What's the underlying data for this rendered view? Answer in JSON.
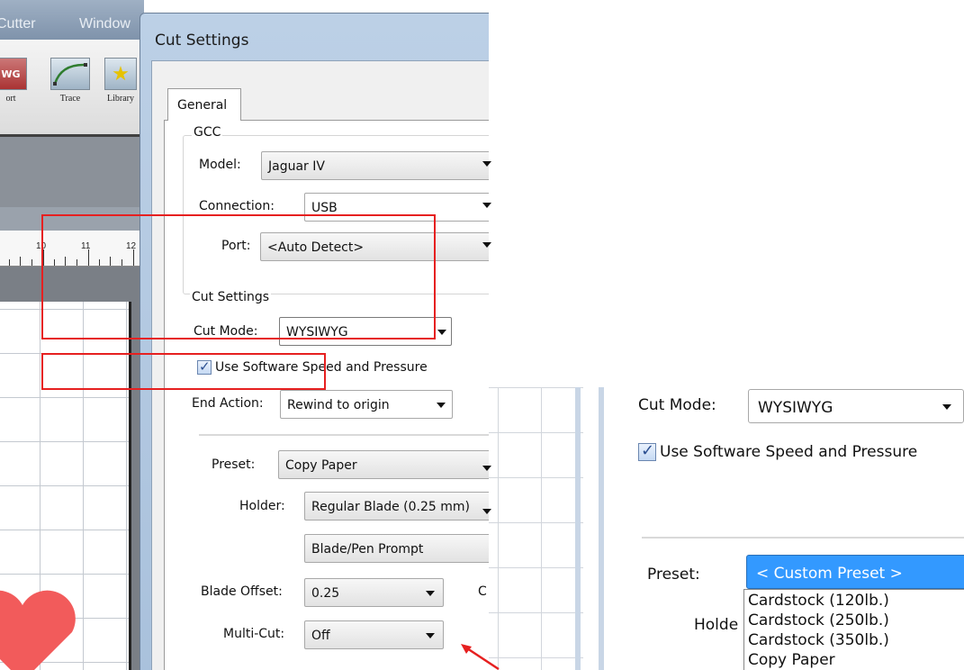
{
  "app": {
    "menu": [
      "Cutter",
      "Window"
    ],
    "tools": [
      {
        "label": "ort",
        "icon": "wysiwyg-icon"
      },
      {
        "label": "Trace",
        "icon": "trace-icon"
      },
      {
        "label": "Library",
        "icon": "star-icon"
      }
    ],
    "ruler": [
      "10",
      "11",
      "12"
    ]
  },
  "dialog": {
    "title": "Cut Settings",
    "tab": "General",
    "gcc": {
      "title": "GCC",
      "model_label": "Model:",
      "model_value": "Jaguar IV",
      "connection_label": "Connection:",
      "connection_value": "USB",
      "port_label": "Port:",
      "port_value": "<Auto Detect>"
    },
    "cut_settings": {
      "title": "Cut Settings",
      "cut_mode_label": "Cut Mode:",
      "cut_mode_value": "WYSIWYG",
      "use_software_label": "Use Software Speed and Pressure",
      "end_action_label": "End Action:",
      "end_action_value": "Rewind to origin"
    },
    "preset_label": "Preset:",
    "preset_value": "Copy Paper",
    "holder_label": "Holder:",
    "holder_value": "Regular Blade (0.25 mm)",
    "blade_prompt_value": "Blade/Pen Prompt",
    "blade_offset_label": "Blade Offset:",
    "blade_offset_value": "0.25",
    "multicut_label": "Multi-Cut:",
    "multicut_value": "Off",
    "right_edge_char": "C"
  },
  "inset": {
    "cut_mode_label": "Cut Mode:",
    "cut_mode_value": "WYSIWYG",
    "use_software_label": "Use Software Speed and Pressure",
    "preset_label": "Preset:",
    "preset_value": "< Custom Preset >",
    "holder_label_partial": "Holde",
    "options": [
      "Cardstock (120lb.)",
      "Cardstock (250lb.)",
      "Cardstock (350lb.)",
      "Copy Paper"
    ]
  },
  "colors": {
    "highlight": "#e62020",
    "selected_option": "#3399ff",
    "heart": "#f25b5b"
  }
}
